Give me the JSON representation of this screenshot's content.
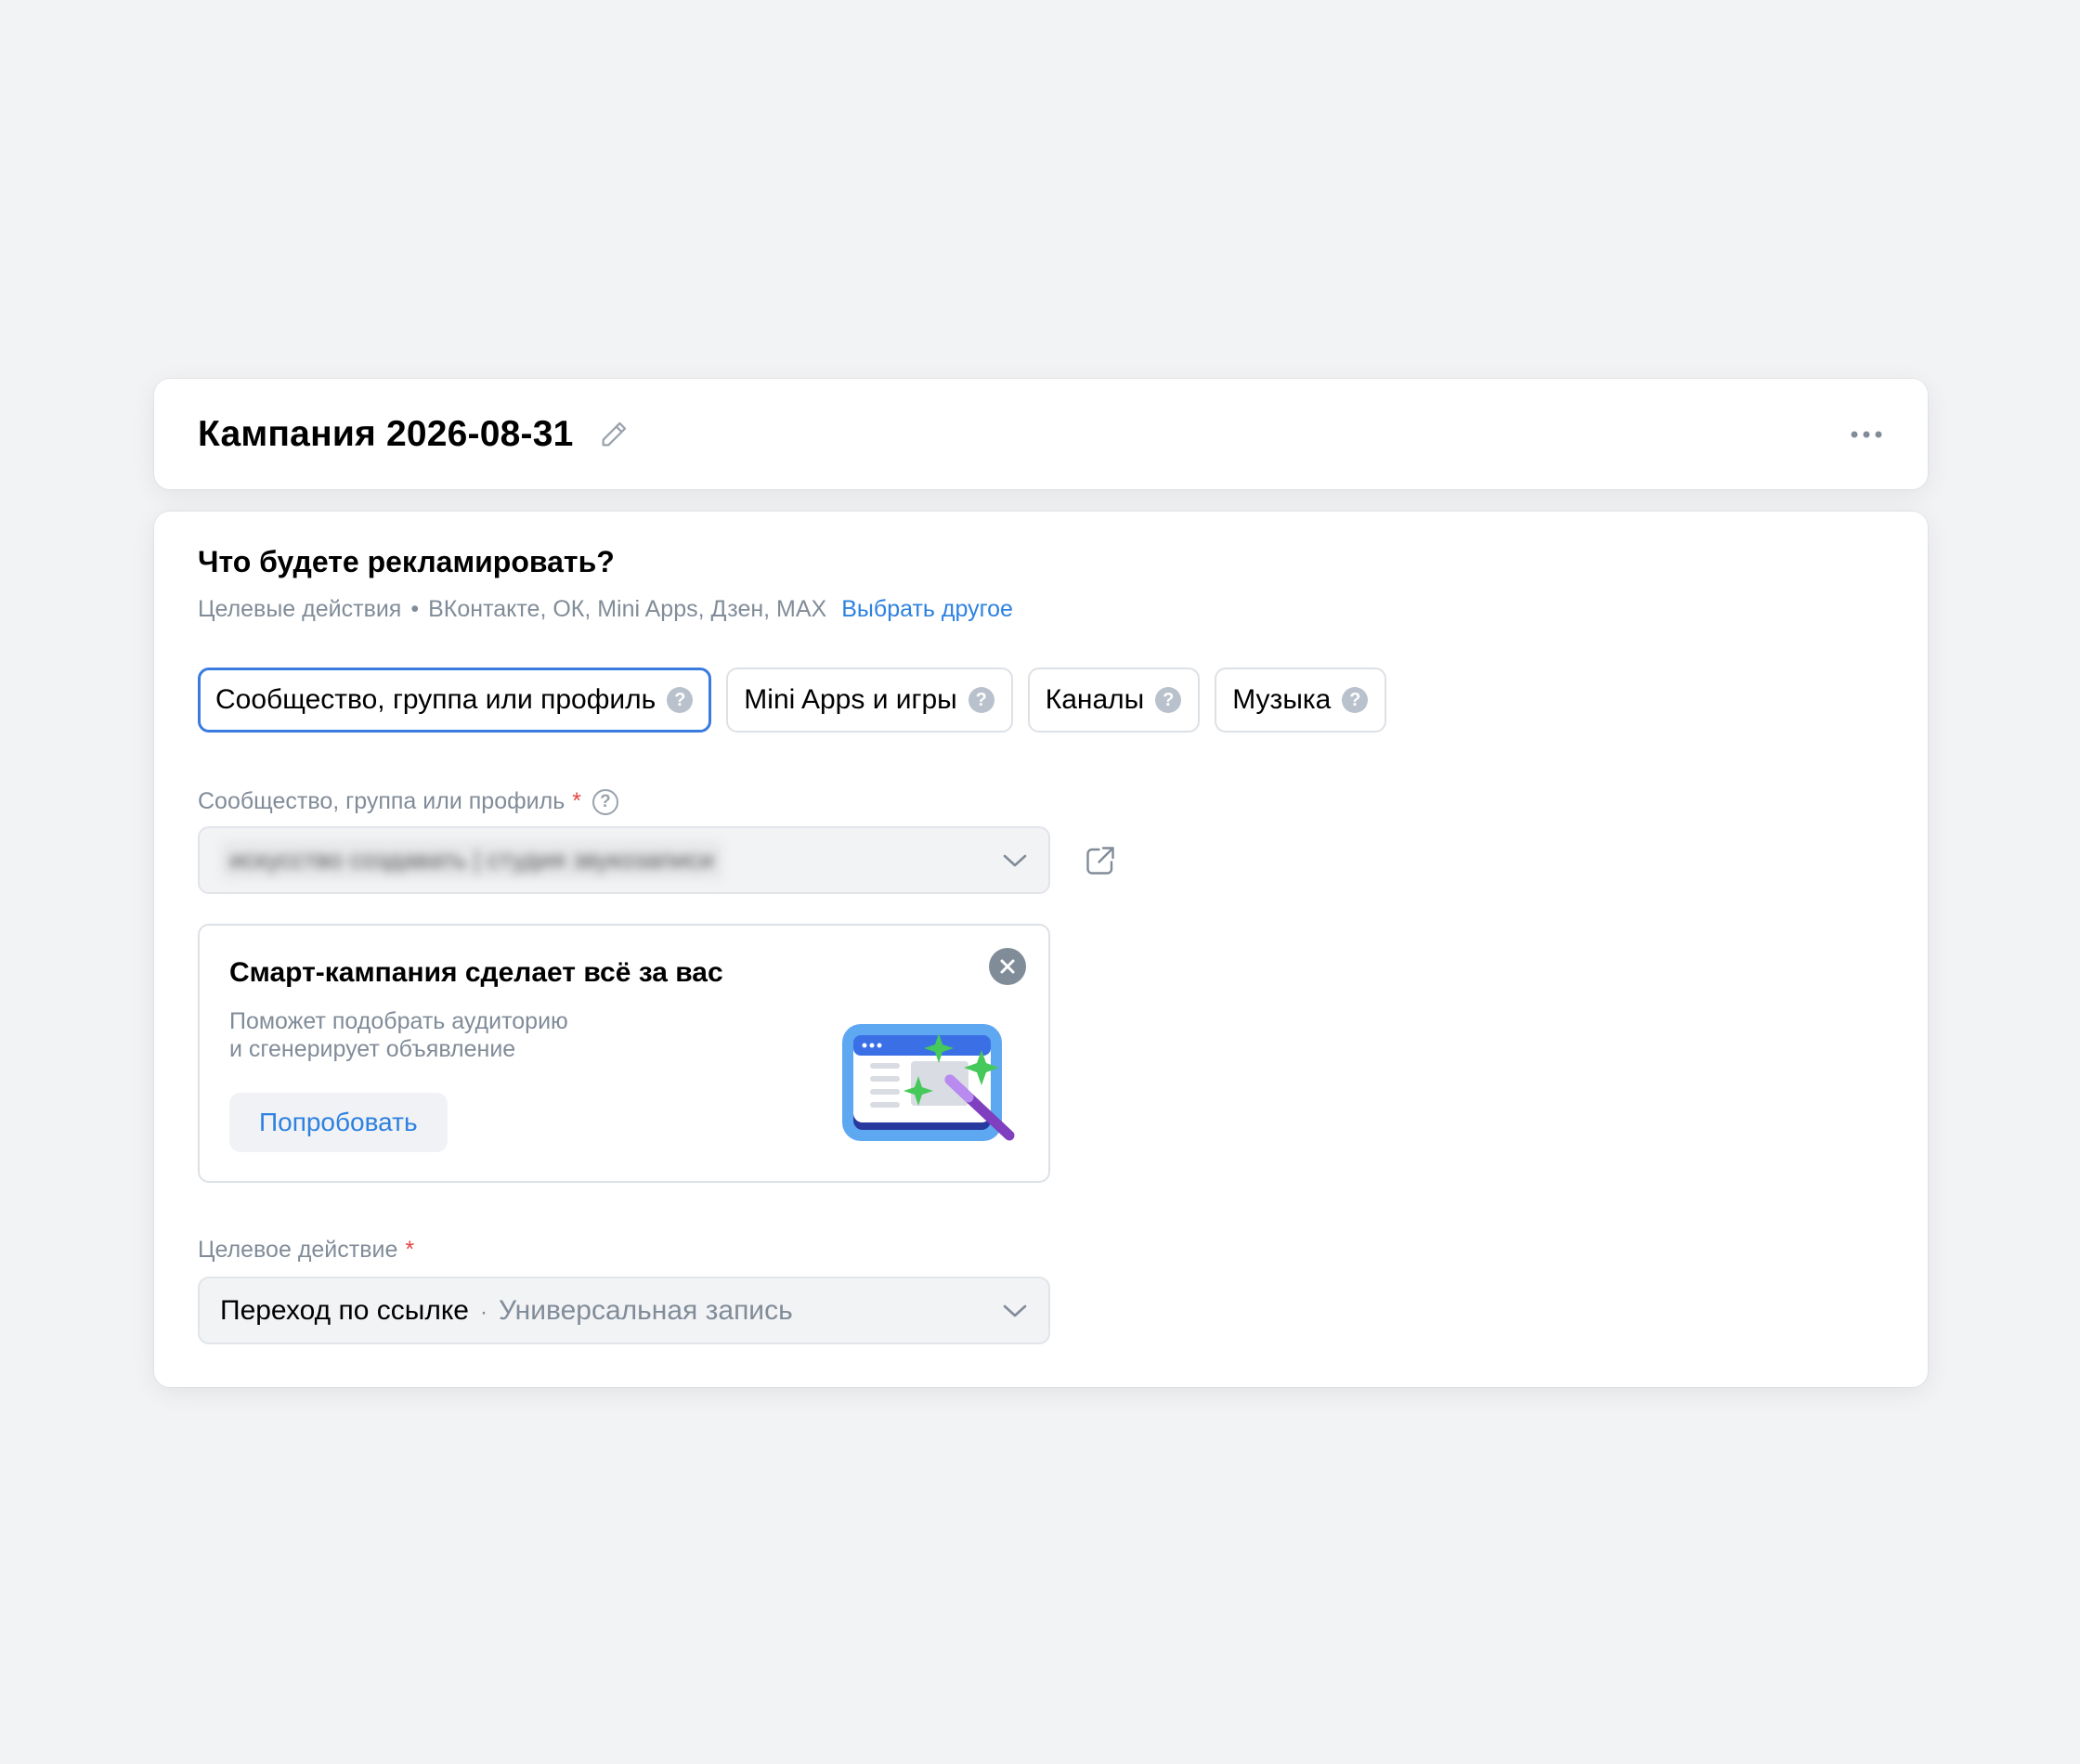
{
  "header": {
    "title": "Кампания 2026-08-31"
  },
  "section": {
    "title": "Что будете рекламировать?",
    "subtitle_part1": "Целевые действия",
    "subtitle_part2": "ВКонтакте, ОК, Mini Apps, Дзен, MAX",
    "link": "Выбрать другое"
  },
  "tabs": [
    {
      "label": "Сообщество, группа или профиль",
      "active": true
    },
    {
      "label": "Mini Apps и игры",
      "active": false
    },
    {
      "label": "Каналы",
      "active": false
    },
    {
      "label": "Музыка",
      "active": false
    }
  ],
  "community_field": {
    "label": "Сообщество, группа или профиль",
    "value": "искусство создавать | студия звукозаписи"
  },
  "promo": {
    "title": "Смарт-кампания сделает всё за вас",
    "text_line1": "Поможет подобрать аудиторию",
    "text_line2": "и сгенерирует объявление",
    "button": "Попробовать"
  },
  "action_field": {
    "label": "Целевое действие",
    "value": "Переход по ссылке",
    "subvalue": "Универсальная запись"
  },
  "colors": {
    "accent": "#2d81e0",
    "active_border": "#3a7be0",
    "required": "#e64646",
    "background": "#f2f3f5"
  }
}
